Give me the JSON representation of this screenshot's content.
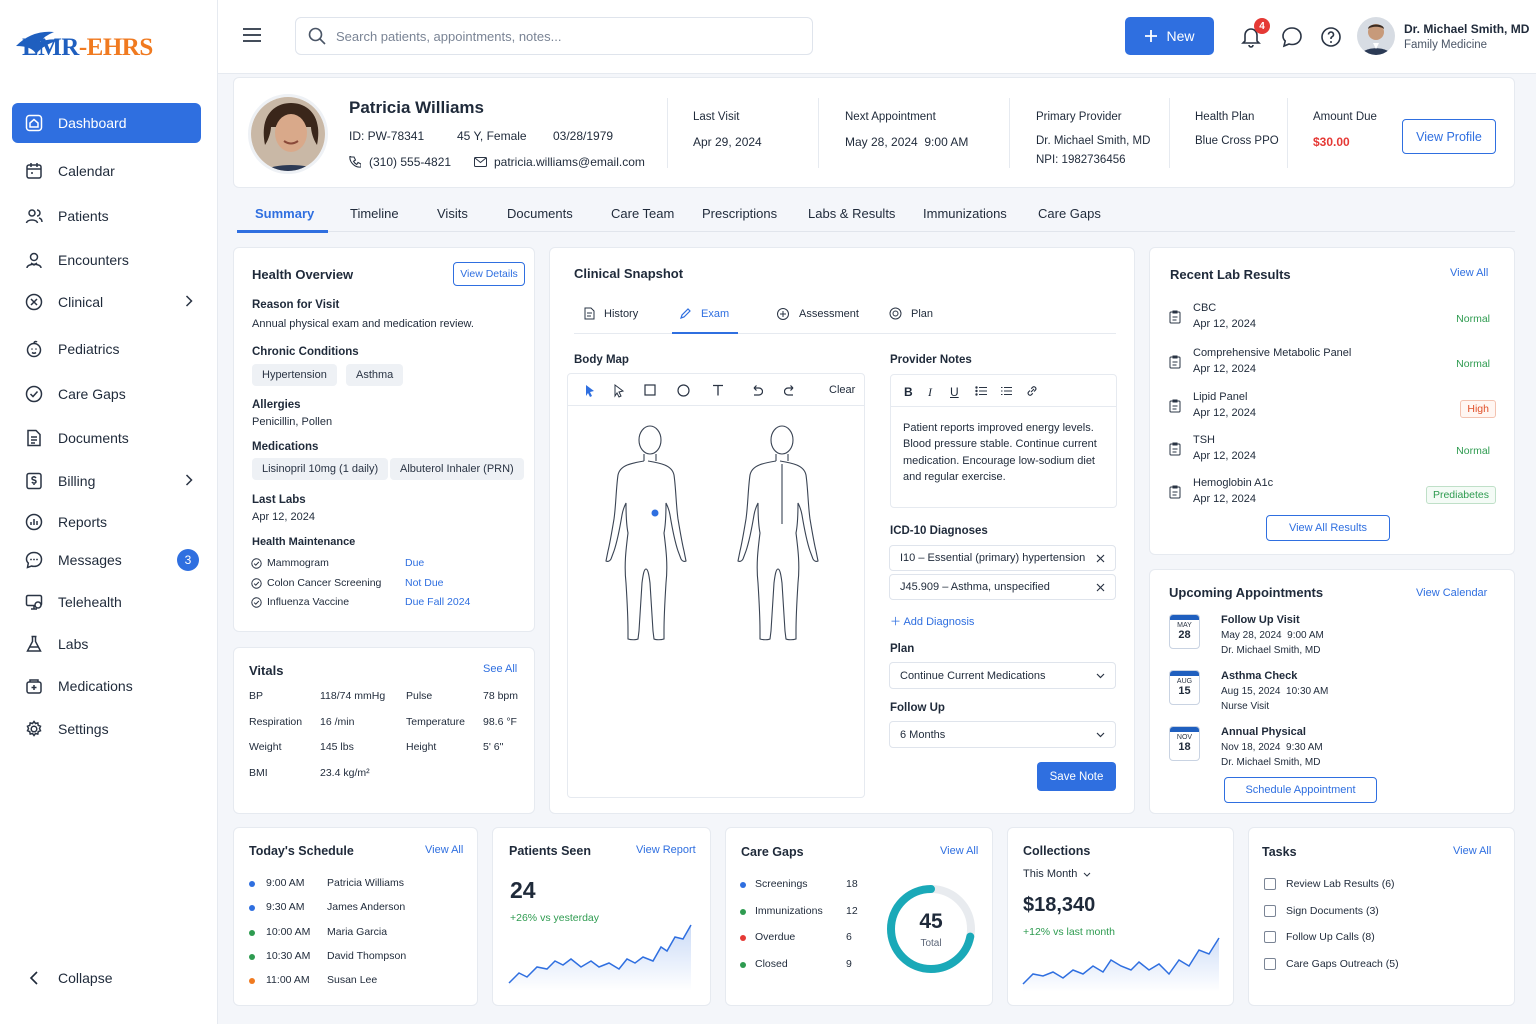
{
  "brand": {
    "logo_left": "EMR",
    "logo_right": "-EHRS"
  },
  "sidebar": {
    "items": [
      {
        "label": "Dashboard",
        "icon": "home-icon"
      },
      {
        "label": "Calendar",
        "icon": "calendar-icon"
      },
      {
        "label": "Patients",
        "icon": "users-icon"
      },
      {
        "label": "Encounters",
        "icon": "encounter-icon"
      },
      {
        "label": "Clinical",
        "icon": "clinical-icon"
      },
      {
        "label": "Pediatrics",
        "icon": "pediatrics-icon"
      },
      {
        "label": "Care Gaps",
        "icon": "care-gaps-icon"
      },
      {
        "label": "Documents",
        "icon": "document-icon"
      },
      {
        "label": "Billing",
        "icon": "billing-icon"
      },
      {
        "label": "Reports",
        "icon": "reports-icon"
      },
      {
        "label": "Messages",
        "icon": "message-icon",
        "badge": "3"
      },
      {
        "label": "Telehealth",
        "icon": "telehealth-icon"
      },
      {
        "label": "Labs",
        "icon": "flask-icon"
      },
      {
        "label": "Medications",
        "icon": "medication-icon"
      },
      {
        "label": "Settings",
        "icon": "gear-icon"
      }
    ],
    "collapse_label": "Collapse"
  },
  "topbar": {
    "search_placeholder": "Search patients, appointments, notes...",
    "new_label": "New",
    "notification_count": "4",
    "user_name": "Dr. Michael Smith, MD",
    "user_role": "Family Medicine"
  },
  "patient": {
    "name": "Patricia Williams",
    "id": "ID: PW-78341",
    "age_sex": "45 Y, Female",
    "dob": "03/28/1979",
    "phone": "(310) 555-4821",
    "email": "patricia.williams@email.com",
    "last_visit_label": "Last Visit",
    "last_visit": "Apr 29, 2024",
    "next_appt_label": "Next Appointment",
    "next_appt": "May 28, 2024  9:00 AM",
    "provider_label": "Primary Provider",
    "provider": "Dr. Michael Smith, MD",
    "npi": "NPI: 1982736456",
    "plan_label": "Health Plan",
    "plan": "Blue Cross PPO",
    "due_label": "Amount Due",
    "due": "$30.00",
    "view_profile": "View Profile"
  },
  "tabs": [
    "Summary",
    "Timeline",
    "Visits",
    "Documents",
    "Care Team",
    "Prescriptions",
    "Labs & Results",
    "Immunizations",
    "Care Gaps"
  ],
  "overview": {
    "title": "Health Overview",
    "view_details": "View Details",
    "reason_label": "Reason for Visit",
    "reason": "Annual physical exam and medication review.",
    "chronic_label": "Chronic Conditions",
    "chronic": [
      "Hypertension",
      "Asthma"
    ],
    "allergies_label": "Allergies",
    "allergies": "Penicillin, Pollen",
    "meds_label": "Medications",
    "meds": [
      "Lisinopril 10mg (1 daily)",
      "Albuterol Inhaler (PRN)"
    ],
    "labs_label": "Last Labs",
    "labs_date": "Apr 12, 2024",
    "maint_label": "Health Maintenance",
    "maint": [
      {
        "name": "Mammogram",
        "status": "Due"
      },
      {
        "name": "Colon Cancer Screening",
        "status": "Not Due"
      },
      {
        "name": "Influenza Vaccine",
        "status": "Due Fall 2024"
      }
    ]
  },
  "vitals": {
    "title": "Vitals",
    "see_all": "See All",
    "rows": [
      {
        "l1": "BP",
        "v1": "118/74 mmHg",
        "l2": "Pulse",
        "v2": "78 bpm"
      },
      {
        "l1": "Respiration",
        "v1": "16 /min",
        "l2": "Temperature",
        "v2": "98.6 °F"
      },
      {
        "l1": "Weight",
        "v1": "145 lbs",
        "l2": "Height",
        "v2": "5' 6\""
      },
      {
        "l1": "BMI",
        "v1": "23.4 kg/m²",
        "l2": "",
        "v2": ""
      }
    ]
  },
  "snapshot": {
    "title": "Clinical Snapshot",
    "subtabs": [
      "History",
      "Exam",
      "Assessment",
      "Plan"
    ],
    "body_map_label": "Body Map",
    "clear": "Clear",
    "notes_label": "Provider Notes",
    "notes": "Patient reports improved energy levels. Blood pressure stable. Continue current medication. Encourage low-sodium diet and regular exercise.",
    "icd_label": "ICD-10 Diagnoses",
    "diagnoses": [
      "I10 – Essential (primary) hypertension",
      "J45.909 – Asthma, unspecified"
    ],
    "add_diag": "Add Diagnosis",
    "plan_label": "Plan",
    "plan_value": "Continue Current Medications",
    "follow_label": "Follow Up",
    "follow_value": "6 Months",
    "save": "Save Note"
  },
  "labs": {
    "title": "Recent Lab Results",
    "view_all": "View All",
    "items": [
      {
        "name": "CBC",
        "date": "Apr 12, 2024",
        "status": "Normal",
        "color": "#2e9b50"
      },
      {
        "name": "Comprehensive Metabolic Panel",
        "date": "Apr 12, 2024",
        "status": "Normal",
        "color": "#2e9b50"
      },
      {
        "name": "Lipid Panel",
        "date": "Apr 12, 2024",
        "status": "High",
        "color": "#e0502a"
      },
      {
        "name": "TSH",
        "date": "Apr 12, 2024",
        "status": "Normal",
        "color": "#2e9b50"
      },
      {
        "name": "Hemoglobin A1c",
        "date": "Apr 12, 2024",
        "status": "Prediabetes",
        "color": "#2e9b50"
      }
    ],
    "view_all_results": "View All Results"
  },
  "appointments": {
    "title": "Upcoming Appointments",
    "view_calendar": "View Calendar",
    "items": [
      {
        "mon": "MAY",
        "day": "28",
        "title": "Follow Up Visit",
        "when": "May 28, 2024  9:00 AM",
        "who": "Dr. Michael Smith, MD"
      },
      {
        "mon": "AUG",
        "day": "15",
        "title": "Asthma Check",
        "when": "Aug 15, 2024  10:30 AM",
        "who": "Nurse Visit"
      },
      {
        "mon": "NOV",
        "day": "18",
        "title": "Annual Physical",
        "when": "Nov 18, 2024  9:30 AM",
        "who": "Dr. Michael Smith, MD"
      }
    ],
    "schedule": "Schedule Appointment"
  },
  "schedule": {
    "title": "Today's Schedule",
    "view_all": "View All",
    "items": [
      {
        "time": "9:00 AM",
        "name": "Patricia Williams",
        "color": "#2f6fe0"
      },
      {
        "time": "9:30 AM",
        "name": "James Anderson",
        "color": "#2f6fe0"
      },
      {
        "time": "10:00 AM",
        "name": "Maria Garcia",
        "color": "#2e9b50"
      },
      {
        "time": "10:30 AM",
        "name": "David Thompson",
        "color": "#2e9b50"
      },
      {
        "time": "11:00 AM",
        "name": "Susan Lee",
        "color": "#f07a20"
      }
    ]
  },
  "patients_seen": {
    "title": "Patients Seen",
    "view_report": "View Report",
    "value": "24",
    "delta": "+26% vs yesterday"
  },
  "care_gaps": {
    "title": "Care Gaps",
    "view_all": "View All",
    "items": [
      {
        "name": "Screenings",
        "count": "18",
        "color": "#2f6fe0"
      },
      {
        "name": "Immunizations",
        "count": "12",
        "color": "#2e9b50"
      },
      {
        "name": "Overdue",
        "count": "6",
        "color": "#e53935"
      },
      {
        "name": "Closed",
        "count": "9",
        "color": "#2e9b50"
      }
    ],
    "total": "45",
    "total_label": "Total"
  },
  "collections": {
    "title": "Collections",
    "period": "This Month",
    "value": "$18,340",
    "delta": "+12% vs last month"
  },
  "tasks": {
    "title": "Tasks",
    "view_all": "View All",
    "items": [
      "Review Lab Results (6)",
      "Sign Documents (3)",
      "Follow Up Calls (8)",
      "Care Gaps Outreach (5)"
    ]
  }
}
